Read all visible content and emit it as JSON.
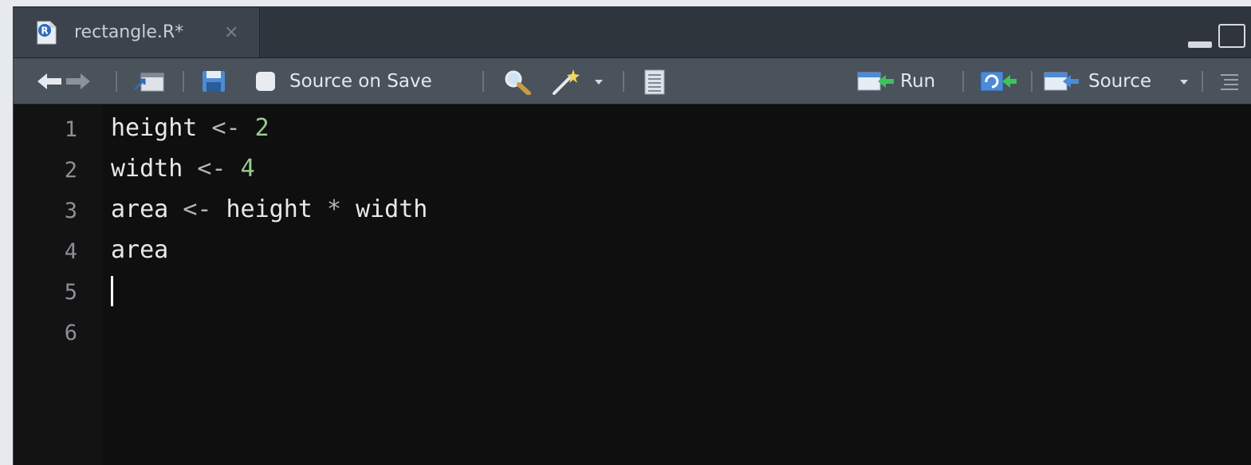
{
  "tab": {
    "file_name": "rectangle.R*",
    "close_glyph": "×",
    "file_icon_letter": "R"
  },
  "toolbar": {
    "source_on_save_label": "Source on Save",
    "source_on_save_checked": false,
    "run_label": "Run",
    "source_label": "Source"
  },
  "editor": {
    "line_numbers": [
      "1",
      "2",
      "3",
      "4",
      "5",
      "6"
    ],
    "lines": [
      [
        {
          "t": "height ",
          "c": "id"
        },
        {
          "t": "<- ",
          "c": "op"
        },
        {
          "t": "2",
          "c": "num"
        }
      ],
      [
        {
          "t": "width ",
          "c": "id"
        },
        {
          "t": "<- ",
          "c": "op"
        },
        {
          "t": "4",
          "c": "num"
        }
      ],
      [
        {
          "t": "area ",
          "c": "id"
        },
        {
          "t": "<- ",
          "c": "op"
        },
        {
          "t": "height ",
          "c": "id"
        },
        {
          "t": "* ",
          "c": "op"
        },
        {
          "t": "width",
          "c": "id"
        }
      ],
      [
        {
          "t": "area",
          "c": "id"
        }
      ],
      [],
      []
    ],
    "cursor_line": 5
  },
  "colors": {
    "editor_bg": "#0f0f0f",
    "toolbar_bg": "#4a525c",
    "number": "#9cc98f",
    "run_arrow": "#3cc45a"
  }
}
